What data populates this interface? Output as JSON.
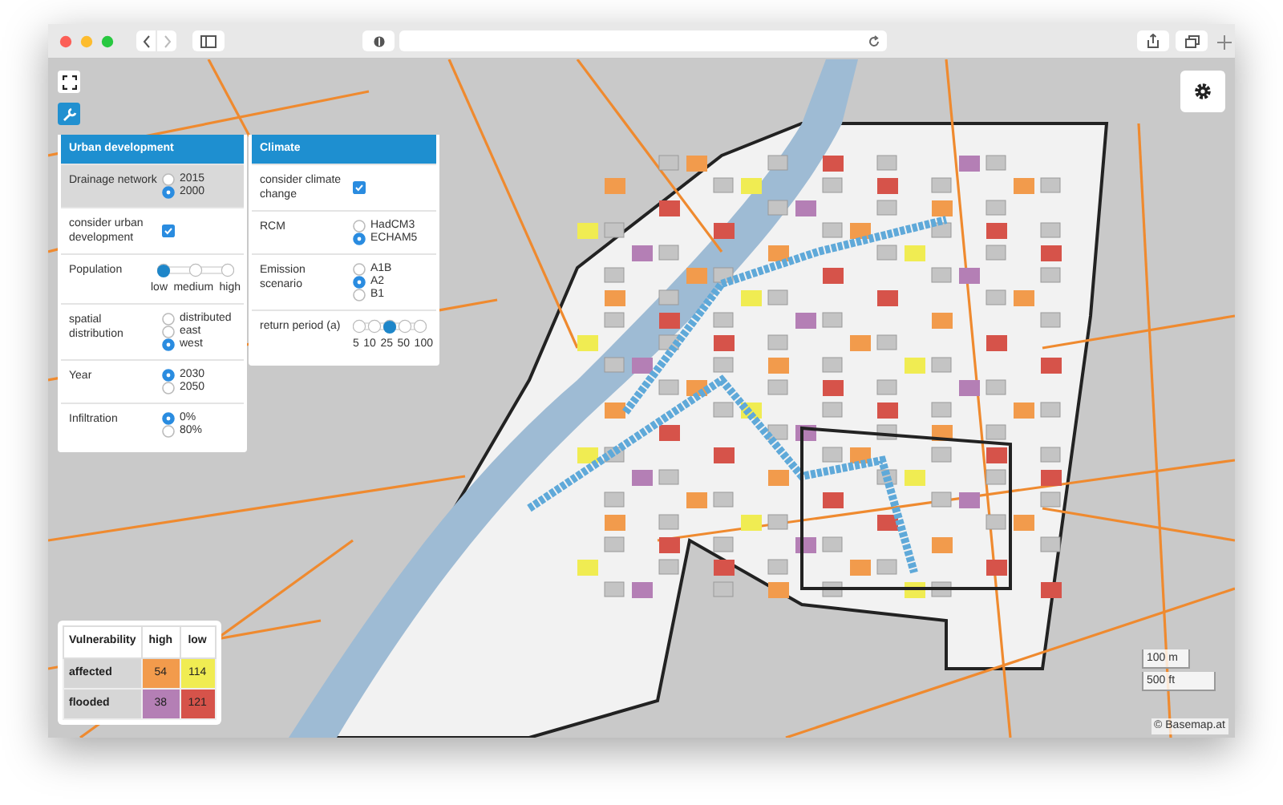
{
  "urban_panel": {
    "title": "Urban development",
    "rows": [
      {
        "kind": "radio",
        "label": "Drainage network",
        "highlighted": true,
        "options": [
          {
            "label": "2015",
            "selected": false
          },
          {
            "label": "2000",
            "selected": true
          }
        ]
      },
      {
        "kind": "checkbox",
        "label": "consider urban development",
        "highlighted": false,
        "checked": true
      },
      {
        "kind": "slider",
        "label": "Population",
        "highlighted": false,
        "level": 0,
        "stops": [
          "low",
          "medium",
          "high"
        ]
      },
      {
        "kind": "radio",
        "label": "spatial distribution",
        "highlighted": false,
        "options": [
          {
            "label": "distributed",
            "selected": false
          },
          {
            "label": "east",
            "selected": false
          },
          {
            "label": "west",
            "selected": true
          }
        ]
      },
      {
        "kind": "radio",
        "label": "Year",
        "highlighted": false,
        "options": [
          {
            "label": "2030",
            "selected": true
          },
          {
            "label": "2050",
            "selected": false
          }
        ]
      },
      {
        "kind": "radio",
        "label": "Infiltration",
        "highlighted": false,
        "options": [
          {
            "label": "0%",
            "selected": true
          },
          {
            "label": "80%",
            "selected": false
          }
        ]
      }
    ]
  },
  "climate_panel": {
    "title": "Climate",
    "rows": [
      {
        "kind": "checkbox",
        "label": "consider climate change",
        "highlighted": false,
        "checked": true
      },
      {
        "kind": "radio",
        "label": "RCM",
        "highlighted": false,
        "options": [
          {
            "label": "HadCM3",
            "selected": false
          },
          {
            "label": "ECHAM5",
            "selected": true
          }
        ]
      },
      {
        "kind": "radio",
        "label": "Emission scenario",
        "highlighted": false,
        "options": [
          {
            "label": "A1B",
            "selected": false
          },
          {
            "label": "A2",
            "selected": true
          },
          {
            "label": "B1",
            "selected": false
          }
        ]
      },
      {
        "kind": "slider",
        "label": "return period (a)",
        "highlighted": false,
        "level": 0.5,
        "stops": [
          "5",
          "10",
          "25",
          "50",
          "100"
        ]
      }
    ]
  },
  "legend": {
    "columns": [
      "Vulnerability",
      "high",
      "low"
    ],
    "rows": [
      {
        "cells": [
          {
            "text": "affected"
          },
          {
            "text": "54",
            "color": "#f29b4c"
          },
          {
            "text": "114",
            "color": "#f0ec52"
          }
        ]
      },
      {
        "cells": [
          {
            "text": "flooded"
          },
          {
            "text": "38",
            "color": "#b47fb5"
          },
          {
            "text": "121",
            "color": "#d6534a"
          }
        ]
      }
    ]
  },
  "scale": [
    "100 m",
    "500 ft"
  ],
  "attribution": "© Basemap.at"
}
